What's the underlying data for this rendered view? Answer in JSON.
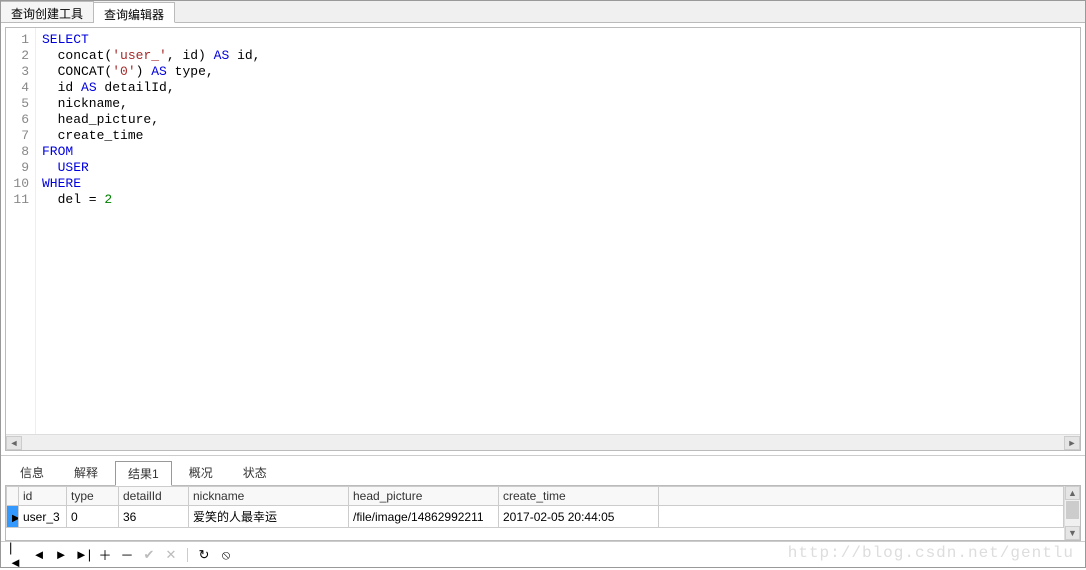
{
  "topTabs": {
    "tab0": "查询创建工具",
    "tab1": "查询编辑器"
  },
  "code": {
    "l1": [
      {
        "t": "SELECT",
        "c": "kw"
      }
    ],
    "l2": [
      {
        "t": "  ",
        "c": ""
      },
      {
        "t": "concat",
        "c": "fn"
      },
      {
        "t": "(",
        "c": ""
      },
      {
        "t": "'user_'",
        "c": "str"
      },
      {
        "t": ", id) ",
        "c": ""
      },
      {
        "t": "AS",
        "c": "kw"
      },
      {
        "t": " id,",
        "c": ""
      }
    ],
    "l3": [
      {
        "t": "  ",
        "c": ""
      },
      {
        "t": "CONCAT",
        "c": "fn"
      },
      {
        "t": "(",
        "c": ""
      },
      {
        "t": "'0'",
        "c": "str"
      },
      {
        "t": ") ",
        "c": ""
      },
      {
        "t": "AS",
        "c": "kw"
      },
      {
        "t": " type,",
        "c": ""
      }
    ],
    "l4": [
      {
        "t": "  id ",
        "c": ""
      },
      {
        "t": "AS",
        "c": "kw"
      },
      {
        "t": " detailId,",
        "c": ""
      }
    ],
    "l5": [
      {
        "t": "  nickname,",
        "c": ""
      }
    ],
    "l6": [
      {
        "t": "  head_picture,",
        "c": ""
      }
    ],
    "l7": [
      {
        "t": "  create_time",
        "c": ""
      }
    ],
    "l8": [
      {
        "t": "FROM",
        "c": "kw"
      }
    ],
    "l9": [
      {
        "t": "  USER",
        "c": "kw"
      }
    ],
    "l10": [
      {
        "t": "WHERE",
        "c": "kw"
      }
    ],
    "l11": [
      {
        "t": "  del = ",
        "c": ""
      },
      {
        "t": "2",
        "c": "num"
      }
    ]
  },
  "bottomTabs": {
    "t0": "信息",
    "t1": "解释",
    "t2": "结果1",
    "t3": "概况",
    "t4": "状态"
  },
  "columns": {
    "id": "id",
    "type": "type",
    "detailId": "detailId",
    "nickname": "nickname",
    "head_picture": "head_picture",
    "create_time": "create_time"
  },
  "row": {
    "id": "user_3",
    "type": "0",
    "detailId": "36",
    "nickname": "爱笑的人最幸运",
    "head_picture": "/file/image/14862992211",
    "create_time": "2017-02-05 20:44:05"
  },
  "watermark": "http://blog.csdn.net/gentlu"
}
